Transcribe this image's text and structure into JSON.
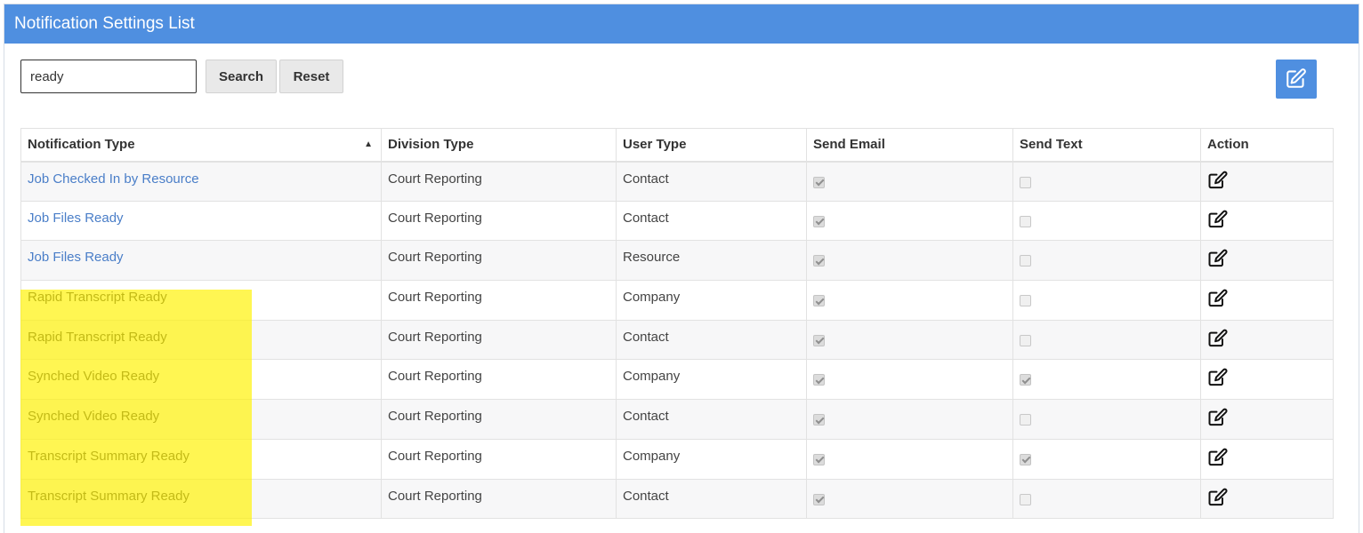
{
  "panel": {
    "title": "Notification Settings List"
  },
  "search": {
    "value": "ready",
    "search_label": "Search",
    "reset_label": "Reset"
  },
  "add_button": {
    "icon": "edit-icon"
  },
  "table": {
    "headers": {
      "notification_type": "Notification Type",
      "division_type": "Division Type",
      "user_type": "User Type",
      "send_email": "Send Email",
      "send_text": "Send Text",
      "action": "Action"
    },
    "sort": {
      "column": "notification_type",
      "direction": "ascending",
      "arrow": "▲"
    },
    "rows": [
      {
        "notification_type": "Job Checked In by Resource",
        "division_type": "Court Reporting",
        "user_type": "Contact",
        "send_email": true,
        "send_text": false,
        "link": true,
        "highlighted": false
      },
      {
        "notification_type": "Job Files Ready",
        "division_type": "Court Reporting",
        "user_type": "Contact",
        "send_email": true,
        "send_text": false,
        "link": true,
        "highlighted": false
      },
      {
        "notification_type": "Job Files Ready",
        "division_type": "Court Reporting",
        "user_type": "Resource",
        "send_email": true,
        "send_text": false,
        "link": true,
        "highlighted": false
      },
      {
        "notification_type": "Rapid Transcript Ready",
        "division_type": "Court Reporting",
        "user_type": "Company",
        "send_email": true,
        "send_text": false,
        "link": false,
        "highlighted": true
      },
      {
        "notification_type": "Rapid Transcript Ready",
        "division_type": "Court Reporting",
        "user_type": "Contact",
        "send_email": true,
        "send_text": false,
        "link": false,
        "highlighted": true
      },
      {
        "notification_type": "Synched Video Ready",
        "division_type": "Court Reporting",
        "user_type": "Company",
        "send_email": true,
        "send_text": true,
        "link": false,
        "highlighted": true
      },
      {
        "notification_type": "Synched Video Ready",
        "division_type": "Court Reporting",
        "user_type": "Contact",
        "send_email": true,
        "send_text": false,
        "link": false,
        "highlighted": true
      },
      {
        "notification_type": "Transcript Summary Ready",
        "division_type": "Court Reporting",
        "user_type": "Company",
        "send_email": true,
        "send_text": true,
        "link": false,
        "highlighted": true
      },
      {
        "notification_type": "Transcript Summary Ready",
        "division_type": "Court Reporting",
        "user_type": "Contact",
        "send_email": true,
        "send_text": false,
        "link": false,
        "highlighted": true
      }
    ]
  },
  "colors": {
    "header_bar": "#4f8fe0",
    "link": "#4a7ec8",
    "highlight": "#fff100"
  }
}
